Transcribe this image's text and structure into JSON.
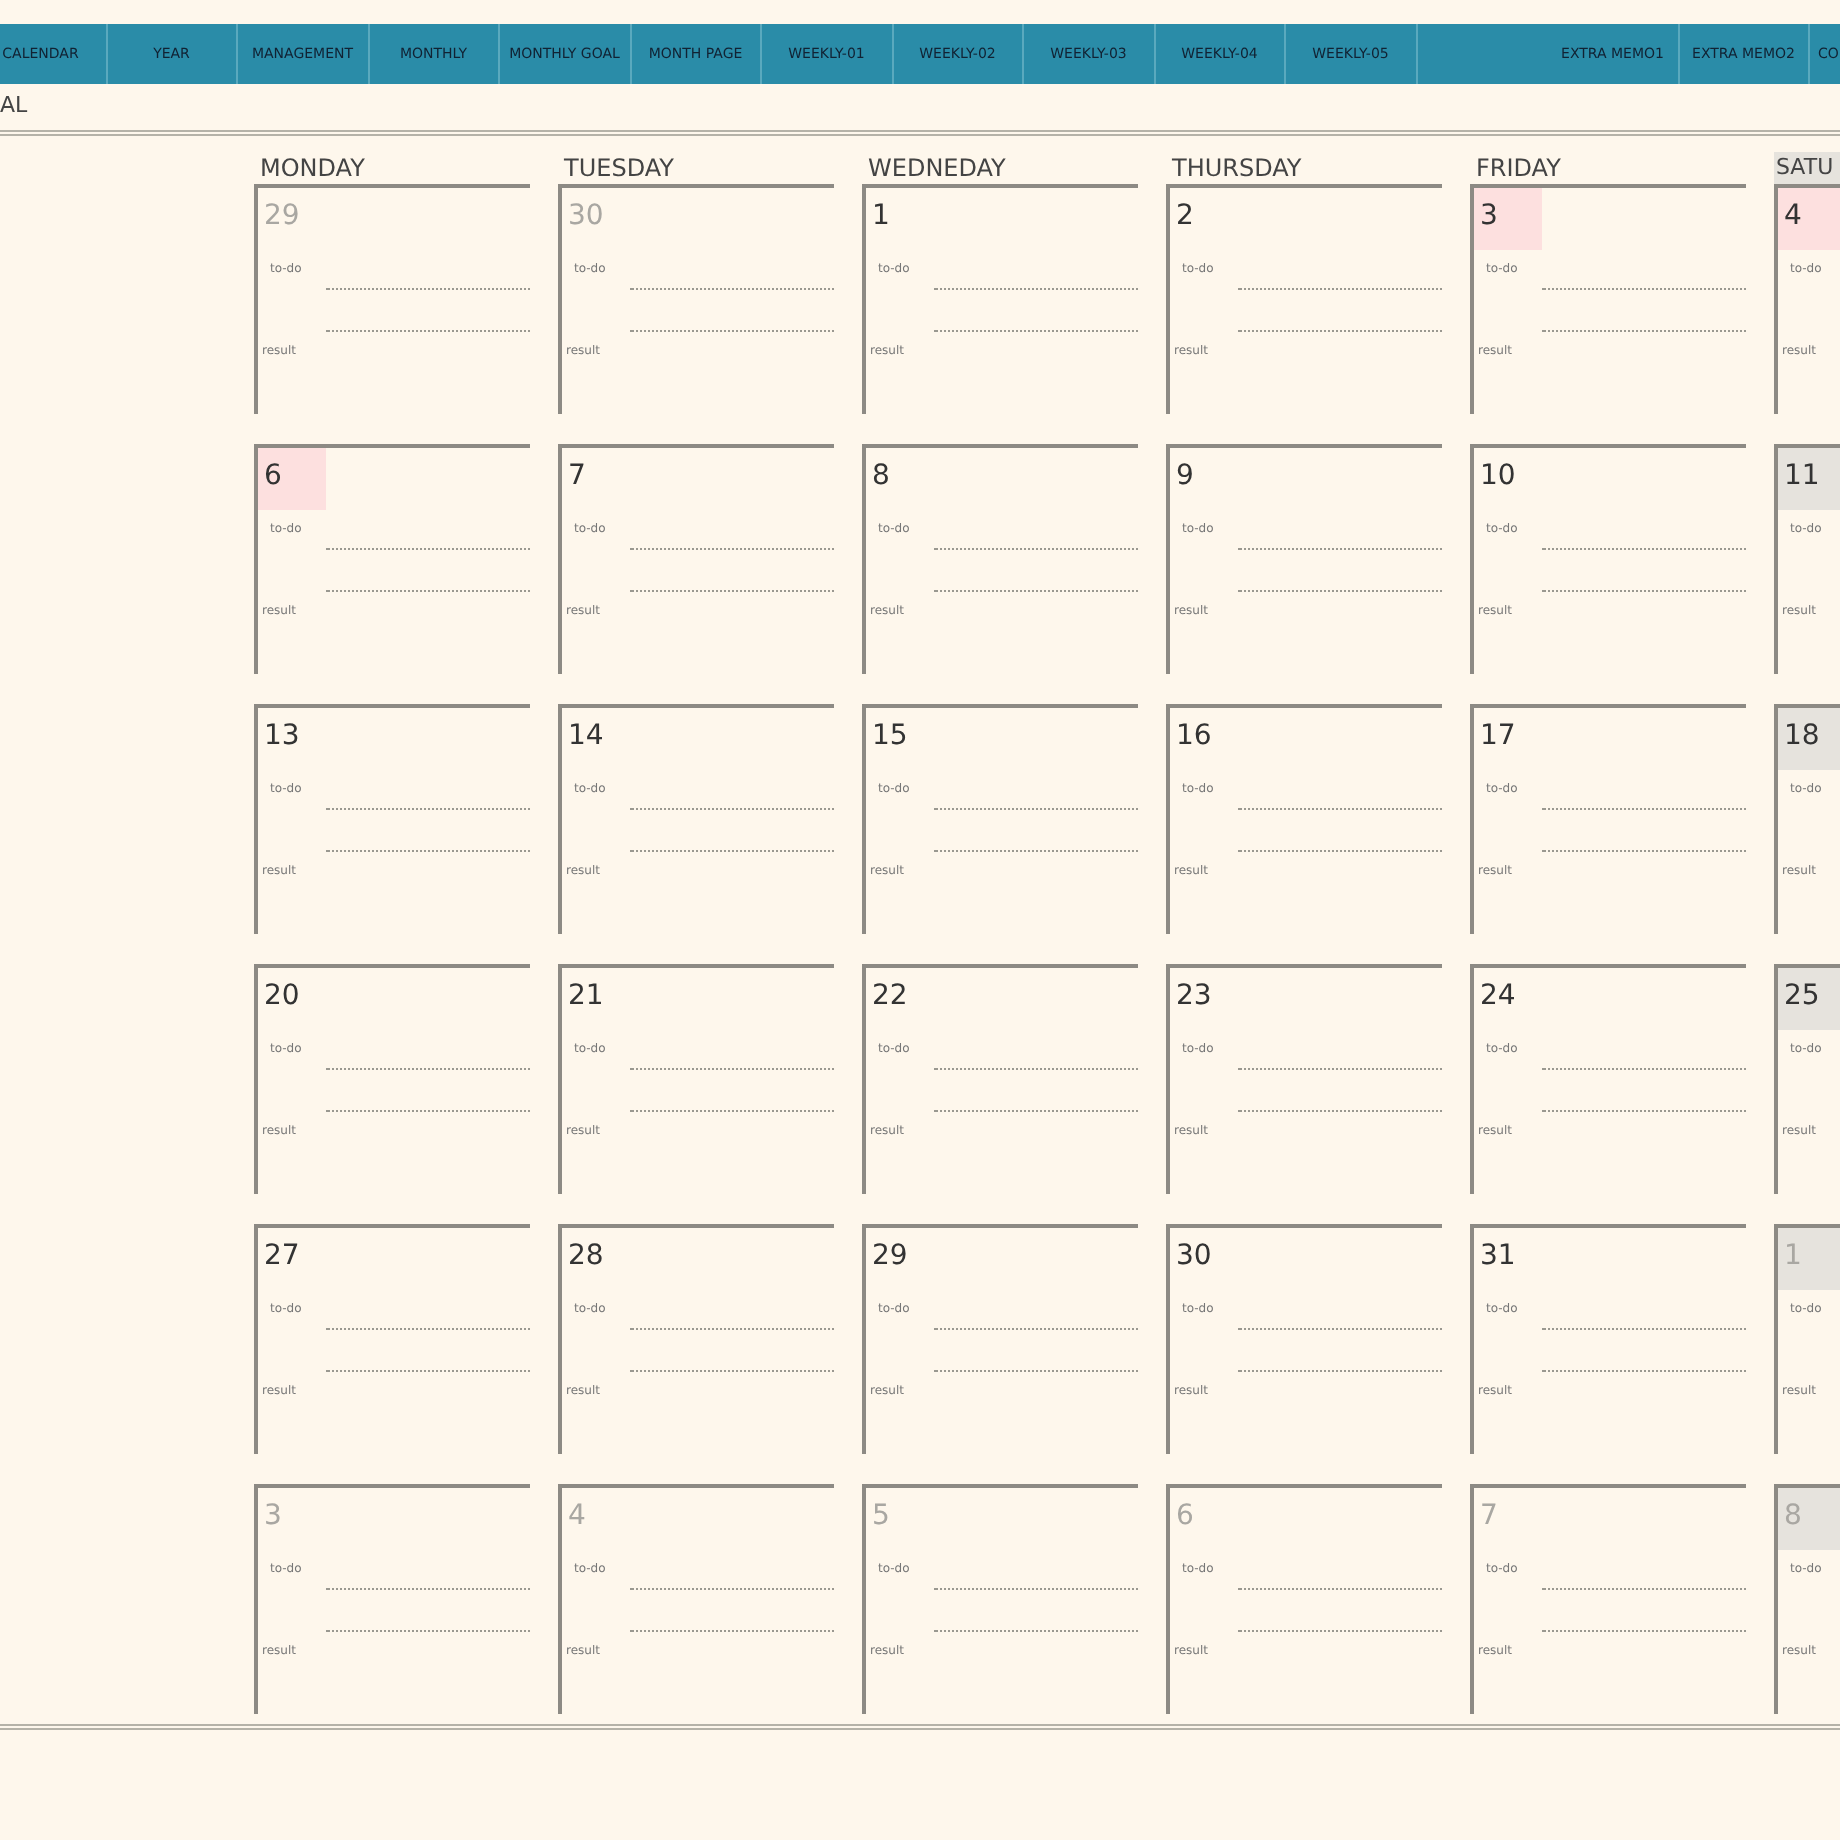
{
  "tabs": [
    {
      "label": "CALENDAR"
    },
    {
      "label": "YEAR"
    },
    {
      "label": "MANAGEMENT"
    },
    {
      "label": "MONTHLY"
    },
    {
      "label": "MONTHLY GOAL"
    },
    {
      "label": "MONTH PAGE"
    },
    {
      "label": "WEEKLY-01"
    },
    {
      "label": "WEEKLY-02"
    },
    {
      "label": "WEEKLY-03"
    },
    {
      "label": "WEEKLY-04"
    },
    {
      "label": "WEEKLY-05"
    },
    {
      "kind": "spacer"
    },
    {
      "label": "EXTRA MEMO1"
    },
    {
      "label": "EXTRA MEMO2"
    },
    {
      "label": "CO"
    }
  ],
  "subtitle": "AL",
  "weekdays": [
    {
      "label": "MONDAY",
      "weekend": false
    },
    {
      "label": "TUESDAY",
      "weekend": false
    },
    {
      "label": "WEDNEDAY",
      "weekend": false
    },
    {
      "label": "THURSDAY",
      "weekend": false
    },
    {
      "label": "FRIDAY",
      "weekend": false
    },
    {
      "label": "SATU",
      "weekend": true
    }
  ],
  "weeks": [
    [
      {
        "date": "29",
        "muted": true,
        "todo": "to-do",
        "result": "result"
      },
      {
        "date": "30",
        "muted": true,
        "todo": "to-do",
        "result": "result"
      },
      {
        "date": "1",
        "muted": false,
        "todo": "to-do",
        "result": "result"
      },
      {
        "date": "2",
        "muted": false,
        "todo": "to-do",
        "result": "result"
      },
      {
        "date": "3",
        "muted": false,
        "color": "#fde0df",
        "todo": "to-do",
        "result": "result"
      },
      {
        "date": "4",
        "muted": false,
        "color": "#fde0df",
        "todo": "to-do",
        "result": "result"
      }
    ],
    [
      {
        "date": "6",
        "muted": false,
        "color": "#fde0df",
        "todo": "to-do",
        "result": "result"
      },
      {
        "date": "7",
        "muted": false,
        "todo": "to-do",
        "result": "result"
      },
      {
        "date": "8",
        "muted": false,
        "todo": "to-do",
        "result": "result"
      },
      {
        "date": "9",
        "muted": false,
        "todo": "to-do",
        "result": "result"
      },
      {
        "date": "10",
        "muted": false,
        "todo": "to-do",
        "result": "result"
      },
      {
        "date": "11",
        "muted": false,
        "color": "#e6e3dd",
        "todo": "to-do",
        "result": "result"
      }
    ],
    [
      {
        "date": "13",
        "muted": false,
        "todo": "to-do",
        "result": "result"
      },
      {
        "date": "14",
        "muted": false,
        "todo": "to-do",
        "result": "result"
      },
      {
        "date": "15",
        "muted": false,
        "todo": "to-do",
        "result": "result"
      },
      {
        "date": "16",
        "muted": false,
        "todo": "to-do",
        "result": "result"
      },
      {
        "date": "17",
        "muted": false,
        "todo": "to-do",
        "result": "result"
      },
      {
        "date": "18",
        "muted": false,
        "color": "#e6e3dd",
        "todo": "to-do",
        "result": "result"
      }
    ],
    [
      {
        "date": "20",
        "muted": false,
        "todo": "to-do",
        "result": "result"
      },
      {
        "date": "21",
        "muted": false,
        "todo": "to-do",
        "result": "result"
      },
      {
        "date": "22",
        "muted": false,
        "todo": "to-do",
        "result": "result"
      },
      {
        "date": "23",
        "muted": false,
        "todo": "to-do",
        "result": "result"
      },
      {
        "date": "24",
        "muted": false,
        "todo": "to-do",
        "result": "result"
      },
      {
        "date": "25",
        "muted": false,
        "color": "#e6e3dd",
        "todo": "to-do",
        "result": "result"
      }
    ],
    [
      {
        "date": "27",
        "muted": false,
        "todo": "to-do",
        "result": "result"
      },
      {
        "date": "28",
        "muted": false,
        "todo": "to-do",
        "result": "result"
      },
      {
        "date": "29",
        "muted": false,
        "todo": "to-do",
        "result": "result"
      },
      {
        "date": "30",
        "muted": false,
        "todo": "to-do",
        "result": "result"
      },
      {
        "date": "31",
        "muted": false,
        "todo": "to-do",
        "result": "result"
      },
      {
        "date": "1",
        "muted": true,
        "color": "#e6e3dd",
        "todo": "to-do",
        "result": "result"
      }
    ],
    [
      {
        "date": "3",
        "muted": true,
        "todo": "to-do",
        "result": "result"
      },
      {
        "date": "4",
        "muted": true,
        "todo": "to-do",
        "result": "result"
      },
      {
        "date": "5",
        "muted": true,
        "todo": "to-do",
        "result": "result"
      },
      {
        "date": "6",
        "muted": true,
        "todo": "to-do",
        "result": "result"
      },
      {
        "date": "7",
        "muted": true,
        "todo": "to-do",
        "result": "result"
      },
      {
        "date": "8",
        "muted": true,
        "color": "#e6e3dd",
        "todo": "to-do",
        "result": "result"
      }
    ]
  ]
}
